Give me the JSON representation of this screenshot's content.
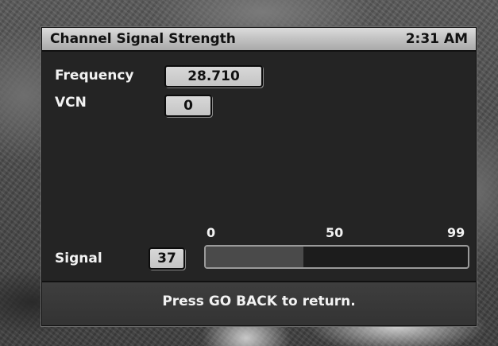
{
  "header": {
    "title": "Channel Signal Strength",
    "time": "2:31 AM"
  },
  "fields": {
    "frequency": {
      "label": "Frequency",
      "value": "28.710"
    },
    "vcn": {
      "label": "VCN",
      "value": "0"
    }
  },
  "signal": {
    "label": "Signal",
    "value": "37",
    "level": 37,
    "min": 0,
    "max": 99,
    "scale": [
      "0",
      "50",
      "99"
    ]
  },
  "footer": {
    "message": "Press GO BACK to return."
  },
  "colors": {
    "panel": "#242424",
    "title_bar": "#c4c4c4",
    "signal_fill": "#4a4a4a"
  }
}
